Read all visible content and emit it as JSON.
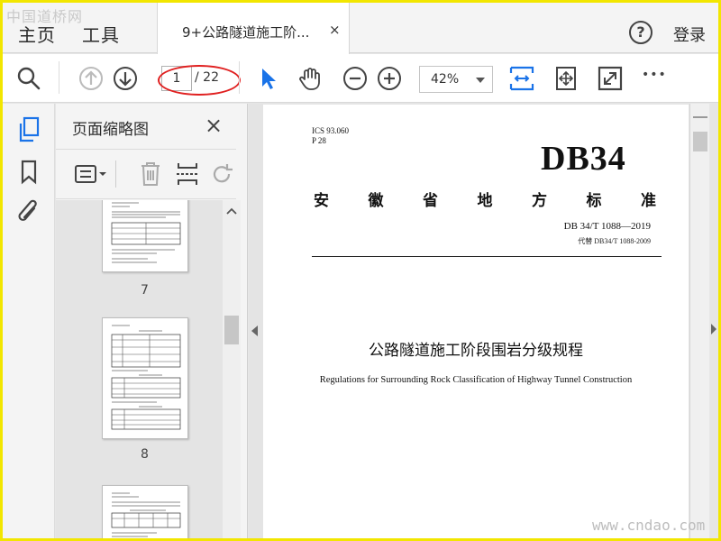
{
  "watermark": {
    "top": "中国道桥网",
    "bottom": "www.cndao.com"
  },
  "menubar": {
    "home": "主页",
    "tools": "工具",
    "tab_title": "9+公路隧道施工阶...",
    "tab_close": "×",
    "help": "?",
    "login": "登录"
  },
  "toolbar": {
    "current_page": "1",
    "total_pages": "/ 22",
    "zoom": "42%",
    "more": "•••"
  },
  "sidebar": {
    "title": "页面缩略图",
    "close": "×",
    "thumbnails": [
      {
        "label": "7"
      },
      {
        "label": "8"
      },
      {
        "label": ""
      }
    ]
  },
  "document": {
    "ics": "ICS 93.060",
    "p": "P 28",
    "code": "DB34",
    "standard_chars": [
      "安",
      "徽",
      "省",
      "地",
      "方",
      "标",
      "准"
    ],
    "std_no": "DB 34/T 1088—2019",
    "replaces": "代替 DB34/T 1088-2009",
    "title_cn": "公路隧道施工阶段围岩分级规程",
    "title_en": "Regulations for Surrounding Rock Classification of Highway Tunnel Construction"
  },
  "colors": {
    "frame": "#f2e600",
    "accent_blue": "#1a73e8",
    "annotation_red": "#e02020"
  }
}
